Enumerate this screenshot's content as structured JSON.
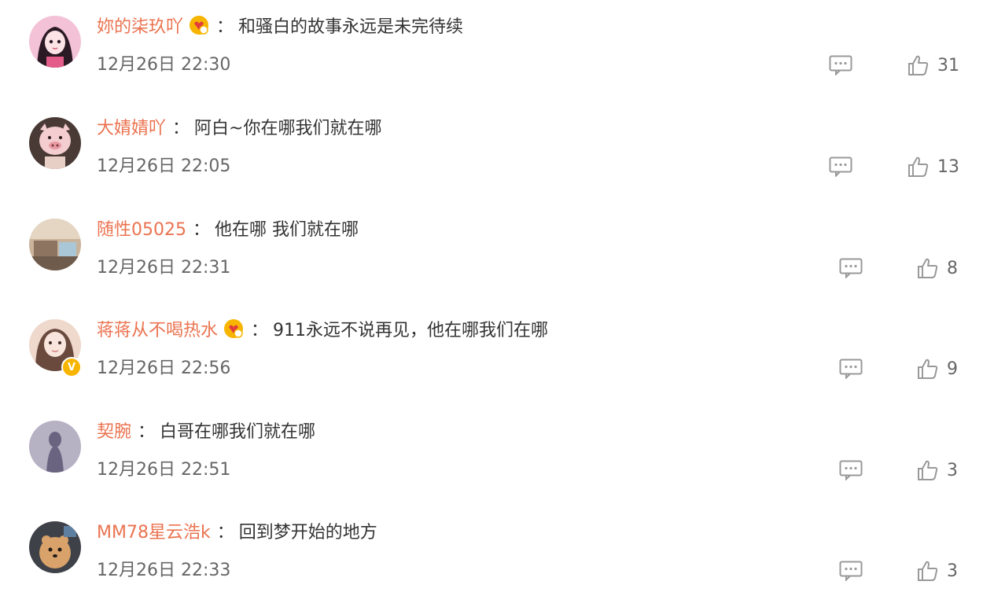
{
  "comments": [
    {
      "username": "妳的柒玖吖",
      "has_badge": true,
      "separator": "：",
      "text": "和骚白的故事永远是未完待续",
      "time": "12月26日 22:30",
      "likes": "31",
      "avatar_icon": "girl-anime-avatar-icon",
      "avatar_colors": [
        "#f3c2d6",
        "#2b1a24"
      ]
    },
    {
      "username": "大婧婧吖",
      "has_badge": false,
      "separator": "：",
      "text": "阿白~你在哪我们就在哪",
      "time": "12月26日 22:05",
      "likes": "13",
      "avatar_icon": "pig-mask-avatar-icon",
      "avatar_colors": [
        "#e7cfc6",
        "#4a3a36"
      ]
    },
    {
      "username": "随性05025",
      "has_badge": false,
      "separator": "：",
      "text": "他在哪 我们就在哪",
      "time": "12月26日 22:31",
      "likes": "8",
      "avatar_icon": "room-photo-avatar-icon",
      "avatar_colors": [
        "#c9b39a",
        "#6f5b4b"
      ]
    },
    {
      "username": "蒋蒋从不喝热水",
      "has_badge": true,
      "separator": "：",
      "text": "911永远不说再见，他在哪我们在哪",
      "time": "12月26日 22:56",
      "likes": "9",
      "avatar_icon": "girl-photo-avatar-icon",
      "avatar_colors": [
        "#efd8cc",
        "#6b4a3e"
      ],
      "verified": true
    },
    {
      "username": "契腕",
      "has_badge": false,
      "separator": "：",
      "text": "白哥在哪我们就在哪",
      "time": "12月26日 22:51",
      "likes": "3",
      "avatar_icon": "silhouette-avatar-icon",
      "avatar_colors": [
        "#b7b1c4",
        "#6b6480"
      ]
    },
    {
      "username": "MM78星云浩k",
      "has_badge": false,
      "separator": "：",
      "text": "回到梦开始的地方",
      "time": "12月26日 22:33",
      "likes": "3",
      "avatar_icon": "dog-avatar-icon",
      "avatar_colors": [
        "#3e4148",
        "#d9a26a"
      ]
    }
  ],
  "colors": {
    "username": "#eb7350",
    "text": "#333333",
    "meta": "#666666",
    "badge": "#f7b500"
  }
}
